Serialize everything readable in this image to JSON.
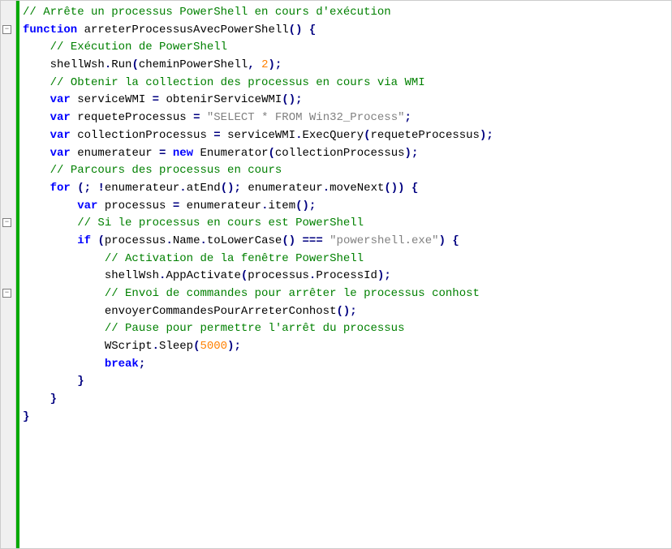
{
  "code": {
    "lines": [
      {
        "indent": 0,
        "tokens": [
          {
            "cls": "tok-comment",
            "t": "// Arrête un processus PowerShell en cours d'exécution"
          }
        ]
      },
      {
        "indent": 0,
        "tokens": [
          {
            "cls": "tok-keyword",
            "t": "function"
          },
          {
            "cls": "tok-ident",
            "t": " arreterProcessusAvecPowerShell"
          },
          {
            "cls": "tok-punct",
            "t": "()"
          },
          {
            "cls": "tok-ident",
            "t": " "
          },
          {
            "cls": "tok-punct",
            "t": "{"
          }
        ]
      },
      {
        "indent": 1,
        "tokens": [
          {
            "cls": "tok-comment",
            "t": "// Exécution de PowerShell"
          }
        ]
      },
      {
        "indent": 1,
        "tokens": [
          {
            "cls": "tok-ident",
            "t": "shellWsh"
          },
          {
            "cls": "tok-punct",
            "t": "."
          },
          {
            "cls": "tok-ident",
            "t": "Run"
          },
          {
            "cls": "tok-punct",
            "t": "("
          },
          {
            "cls": "tok-ident",
            "t": "cheminPowerShell"
          },
          {
            "cls": "tok-punct",
            "t": ","
          },
          {
            "cls": "tok-ident",
            "t": " "
          },
          {
            "cls": "tok-number",
            "t": "2"
          },
          {
            "cls": "tok-punct",
            "t": ");"
          }
        ]
      },
      {
        "indent": 0,
        "tokens": [
          {
            "cls": "tok-ident",
            "t": ""
          }
        ]
      },
      {
        "indent": 1,
        "tokens": [
          {
            "cls": "tok-comment",
            "t": "// Obtenir la collection des processus en cours via WMI"
          }
        ]
      },
      {
        "indent": 1,
        "tokens": [
          {
            "cls": "tok-keyword",
            "t": "var"
          },
          {
            "cls": "tok-ident",
            "t": " serviceWMI "
          },
          {
            "cls": "tok-punct",
            "t": "="
          },
          {
            "cls": "tok-ident",
            "t": " obtenirServiceWMI"
          },
          {
            "cls": "tok-punct",
            "t": "();"
          }
        ]
      },
      {
        "indent": 1,
        "tokens": [
          {
            "cls": "tok-keyword",
            "t": "var"
          },
          {
            "cls": "tok-ident",
            "t": " requeteProcessus "
          },
          {
            "cls": "tok-punct",
            "t": "="
          },
          {
            "cls": "tok-ident",
            "t": " "
          },
          {
            "cls": "tok-string",
            "t": "\"SELECT * FROM Win32_Process\""
          },
          {
            "cls": "tok-punct",
            "t": ";"
          }
        ]
      },
      {
        "indent": 1,
        "tokens": [
          {
            "cls": "tok-keyword",
            "t": "var"
          },
          {
            "cls": "tok-ident",
            "t": " collectionProcessus "
          },
          {
            "cls": "tok-punct",
            "t": "="
          },
          {
            "cls": "tok-ident",
            "t": " serviceWMI"
          },
          {
            "cls": "tok-punct",
            "t": "."
          },
          {
            "cls": "tok-ident",
            "t": "ExecQuery"
          },
          {
            "cls": "tok-punct",
            "t": "("
          },
          {
            "cls": "tok-ident",
            "t": "requeteProcessus"
          },
          {
            "cls": "tok-punct",
            "t": ");"
          }
        ]
      },
      {
        "indent": 1,
        "tokens": [
          {
            "cls": "tok-keyword",
            "t": "var"
          },
          {
            "cls": "tok-ident",
            "t": " enumerateur "
          },
          {
            "cls": "tok-punct",
            "t": "="
          },
          {
            "cls": "tok-ident",
            "t": " "
          },
          {
            "cls": "tok-keyword",
            "t": "new"
          },
          {
            "cls": "tok-ident",
            "t": " Enumerator"
          },
          {
            "cls": "tok-punct",
            "t": "("
          },
          {
            "cls": "tok-ident",
            "t": "collectionProcessus"
          },
          {
            "cls": "tok-punct",
            "t": ");"
          }
        ]
      },
      {
        "indent": 0,
        "tokens": [
          {
            "cls": "tok-ident",
            "t": ""
          }
        ]
      },
      {
        "indent": 1,
        "tokens": [
          {
            "cls": "tok-comment",
            "t": "// Parcours des processus en cours"
          }
        ]
      },
      {
        "indent": 1,
        "tokens": [
          {
            "cls": "tok-keyword",
            "t": "for"
          },
          {
            "cls": "tok-ident",
            "t": " "
          },
          {
            "cls": "tok-punct",
            "t": "(;"
          },
          {
            "cls": "tok-ident",
            "t": " "
          },
          {
            "cls": "tok-punct",
            "t": "!"
          },
          {
            "cls": "tok-ident",
            "t": "enumerateur"
          },
          {
            "cls": "tok-punct",
            "t": "."
          },
          {
            "cls": "tok-ident",
            "t": "atEnd"
          },
          {
            "cls": "tok-punct",
            "t": "();"
          },
          {
            "cls": "tok-ident",
            "t": " enumerateur"
          },
          {
            "cls": "tok-punct",
            "t": "."
          },
          {
            "cls": "tok-ident",
            "t": "moveNext"
          },
          {
            "cls": "tok-punct",
            "t": "())"
          },
          {
            "cls": "tok-ident",
            "t": " "
          },
          {
            "cls": "tok-punct",
            "t": "{"
          }
        ]
      },
      {
        "indent": 2,
        "tokens": [
          {
            "cls": "tok-keyword",
            "t": "var"
          },
          {
            "cls": "tok-ident",
            "t": " processus "
          },
          {
            "cls": "tok-punct",
            "t": "="
          },
          {
            "cls": "tok-ident",
            "t": " enumerateur"
          },
          {
            "cls": "tok-punct",
            "t": "."
          },
          {
            "cls": "tok-ident",
            "t": "item"
          },
          {
            "cls": "tok-punct",
            "t": "();"
          }
        ]
      },
      {
        "indent": 0,
        "tokens": [
          {
            "cls": "tok-ident",
            "t": ""
          }
        ]
      },
      {
        "indent": 2,
        "tokens": [
          {
            "cls": "tok-comment",
            "t": "// Si le processus en cours est PowerShell"
          }
        ]
      },
      {
        "indent": 2,
        "tokens": [
          {
            "cls": "tok-keyword",
            "t": "if"
          },
          {
            "cls": "tok-ident",
            "t": " "
          },
          {
            "cls": "tok-punct",
            "t": "("
          },
          {
            "cls": "tok-ident",
            "t": "processus"
          },
          {
            "cls": "tok-punct",
            "t": "."
          },
          {
            "cls": "tok-ident",
            "t": "Name"
          },
          {
            "cls": "tok-punct",
            "t": "."
          },
          {
            "cls": "tok-ident",
            "t": "toLowerCase"
          },
          {
            "cls": "tok-punct",
            "t": "()"
          },
          {
            "cls": "tok-ident",
            "t": " "
          },
          {
            "cls": "tok-punct",
            "t": "==="
          },
          {
            "cls": "tok-ident",
            "t": " "
          },
          {
            "cls": "tok-string",
            "t": "\"powershell.exe\""
          },
          {
            "cls": "tok-punct",
            "t": ")"
          },
          {
            "cls": "tok-ident",
            "t": " "
          },
          {
            "cls": "tok-punct",
            "t": "{"
          }
        ]
      },
      {
        "indent": 3,
        "tokens": [
          {
            "cls": "tok-comment",
            "t": "// Activation de la fenêtre PowerShell"
          }
        ]
      },
      {
        "indent": 3,
        "tokens": [
          {
            "cls": "tok-ident",
            "t": "shellWsh"
          },
          {
            "cls": "tok-punct",
            "t": "."
          },
          {
            "cls": "tok-ident",
            "t": "AppActivate"
          },
          {
            "cls": "tok-punct",
            "t": "("
          },
          {
            "cls": "tok-ident",
            "t": "processus"
          },
          {
            "cls": "tok-punct",
            "t": "."
          },
          {
            "cls": "tok-ident",
            "t": "ProcessId"
          },
          {
            "cls": "tok-punct",
            "t": ");"
          }
        ]
      },
      {
        "indent": 0,
        "tokens": [
          {
            "cls": "tok-ident",
            "t": ""
          }
        ]
      },
      {
        "indent": 3,
        "tokens": [
          {
            "cls": "tok-comment",
            "t": "// Envoi de commandes pour arrêter le processus conhost"
          }
        ]
      },
      {
        "indent": 3,
        "tokens": [
          {
            "cls": "tok-ident",
            "t": "envoyerCommandesPourArreterConhost"
          },
          {
            "cls": "tok-punct",
            "t": "();"
          }
        ]
      },
      {
        "indent": 0,
        "tokens": [
          {
            "cls": "tok-ident",
            "t": ""
          }
        ]
      },
      {
        "indent": 3,
        "tokens": [
          {
            "cls": "tok-comment",
            "t": "// Pause pour permettre l'arrêt du processus"
          }
        ]
      },
      {
        "indent": 3,
        "tokens": [
          {
            "cls": "tok-ident",
            "t": "WScript"
          },
          {
            "cls": "tok-punct",
            "t": "."
          },
          {
            "cls": "tok-ident",
            "t": "Sleep"
          },
          {
            "cls": "tok-punct",
            "t": "("
          },
          {
            "cls": "tok-number",
            "t": "5000"
          },
          {
            "cls": "tok-punct",
            "t": ");"
          }
        ]
      },
      {
        "indent": 3,
        "tokens": [
          {
            "cls": "tok-keyword",
            "t": "break"
          },
          {
            "cls": "tok-punct",
            "t": ";"
          }
        ]
      },
      {
        "indent": 2,
        "tokens": [
          {
            "cls": "tok-punct",
            "t": "}"
          }
        ]
      },
      {
        "indent": 1,
        "tokens": [
          {
            "cls": "tok-punct",
            "t": "}"
          }
        ]
      },
      {
        "indent": 0,
        "tokens": [
          {
            "cls": "tok-punct",
            "t": "}"
          }
        ]
      }
    ]
  },
  "fold_markers": [
    {
      "line_index": 1
    },
    {
      "line_index": 12
    },
    {
      "line_index": 16
    }
  ],
  "indent_unit": "    ",
  "fold_glyph": "−"
}
